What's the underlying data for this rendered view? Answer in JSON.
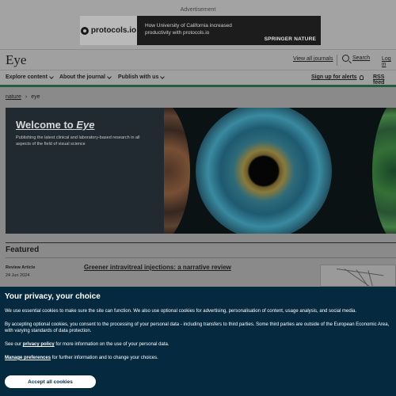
{
  "ad": {
    "label": "Advertisement",
    "logo_text": "protocols.io",
    "copy": "How University of California increased productivity with protocols.io",
    "brand": "SPRINGER NATURE"
  },
  "header": {
    "logo": "Eye",
    "view_all_journals": "View all journals",
    "search": "Search",
    "login": "Log in"
  },
  "nav": {
    "items": [
      {
        "label": "Explore content"
      },
      {
        "label": "About the journal"
      },
      {
        "label": "Publish with us"
      }
    ],
    "alerts": "Sign up for alerts",
    "rss": "RSS feed"
  },
  "breadcrumb": {
    "root": "nature",
    "separator": "›",
    "current": "eye"
  },
  "hero": {
    "title_prefix": "Welcome to ",
    "title_italic": "Eye",
    "description": "Publishing the latest clinical and laboratory-based research in all aspects of the field of visual science"
  },
  "featured": {
    "heading": "Featured",
    "article": {
      "type": "Review Article",
      "date": "24 Jun 2024",
      "title": "Greener intravitreal injections: a narrative review"
    }
  },
  "cookie": {
    "title": "Your privacy, your choice",
    "p1": "We use essential cookies to make sure the site can function. We also use optional cookies for advertising, personalisation of content, usage analysis, and social media.",
    "p2": "By accepting optional cookies, you consent to the processing of your personal data - including transfers to third parties. Some third parties are outside of the European Economic Area, with varying standards of data protection.",
    "p3_prefix": "See our ",
    "p3_link": "privacy policy",
    "p3_suffix": " for more information on the use of your personal data.",
    "p4_link": "Manage preferences",
    "p4_suffix": " for further information and to change your choices.",
    "accept": "Accept all cookies"
  },
  "colors": {
    "cookie_bg": "#052a40",
    "accent_green": "#245d43"
  }
}
